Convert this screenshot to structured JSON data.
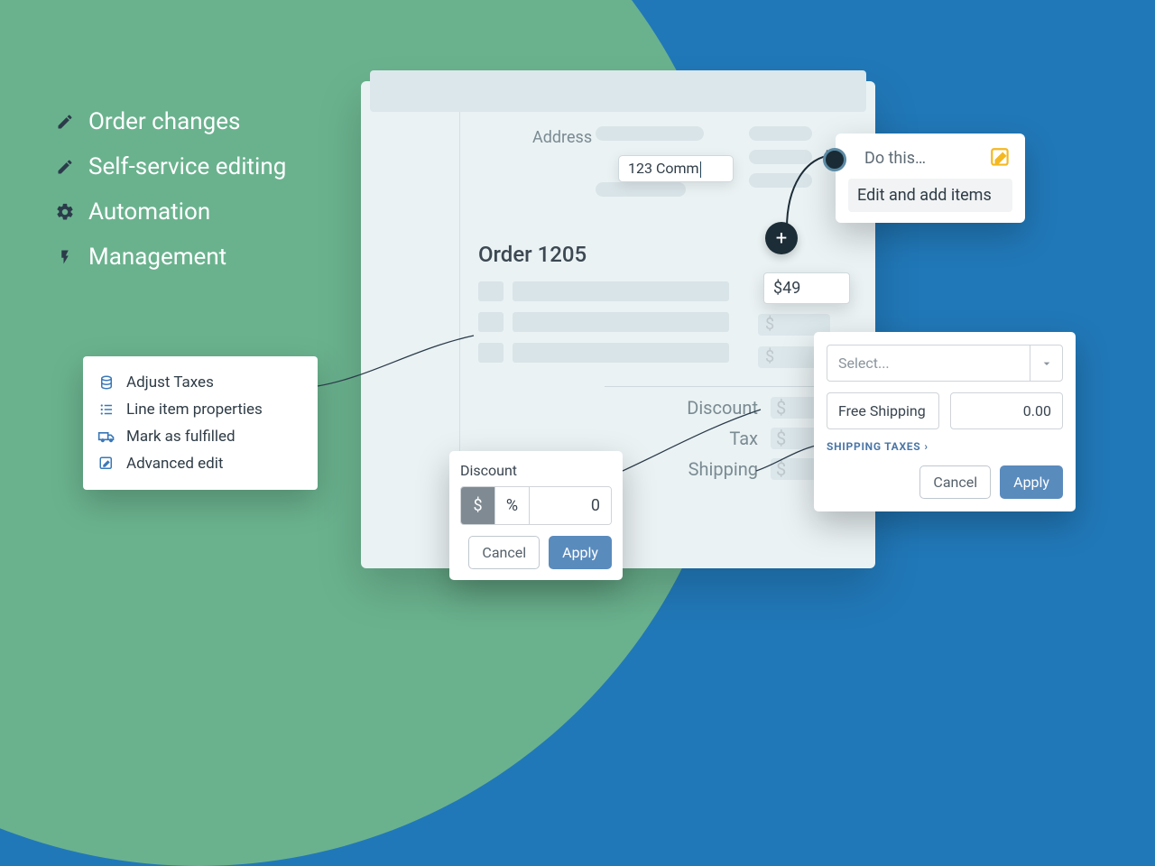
{
  "features": {
    "items": [
      {
        "icon": "pencil-icon",
        "label": "Order changes"
      },
      {
        "icon": "pencil-icon",
        "label": "Self-service editing"
      },
      {
        "icon": "gears-icon",
        "label": "Automation"
      },
      {
        "icon": "bolt-icon",
        "label": "Management"
      }
    ]
  },
  "order": {
    "address_label": "Address",
    "address_value": "123 Comm",
    "title": "Order 1205",
    "price_input": "$49",
    "money_placeholder": "$",
    "totals": {
      "discount_label": "Discount",
      "tax_label": "Tax",
      "shipping_label": "Shipping"
    }
  },
  "plus_label": "+",
  "automation": {
    "dot": "●",
    "do_this": "Do this…",
    "action": "Edit and add items"
  },
  "actions_menu": {
    "items": [
      {
        "icon": "stack-icon",
        "label": "Adjust Taxes"
      },
      {
        "icon": "list-icon",
        "label": "Line item properties"
      },
      {
        "icon": "truck-icon",
        "label": "Mark as fulfilled"
      },
      {
        "icon": "edit-square-icon",
        "label": "Advanced edit"
      }
    ]
  },
  "discount_pop": {
    "title": "Discount",
    "dollar": "$",
    "percent": "%",
    "value": "0",
    "cancel": "Cancel",
    "apply": "Apply"
  },
  "ship_pop": {
    "select_placeholder": "Select...",
    "name_value": "Free Shipping",
    "amount_value": "0.00",
    "taxes_label": "SHIPPING TAXES",
    "caret": "›",
    "cancel": "Cancel",
    "apply": "Apply"
  }
}
